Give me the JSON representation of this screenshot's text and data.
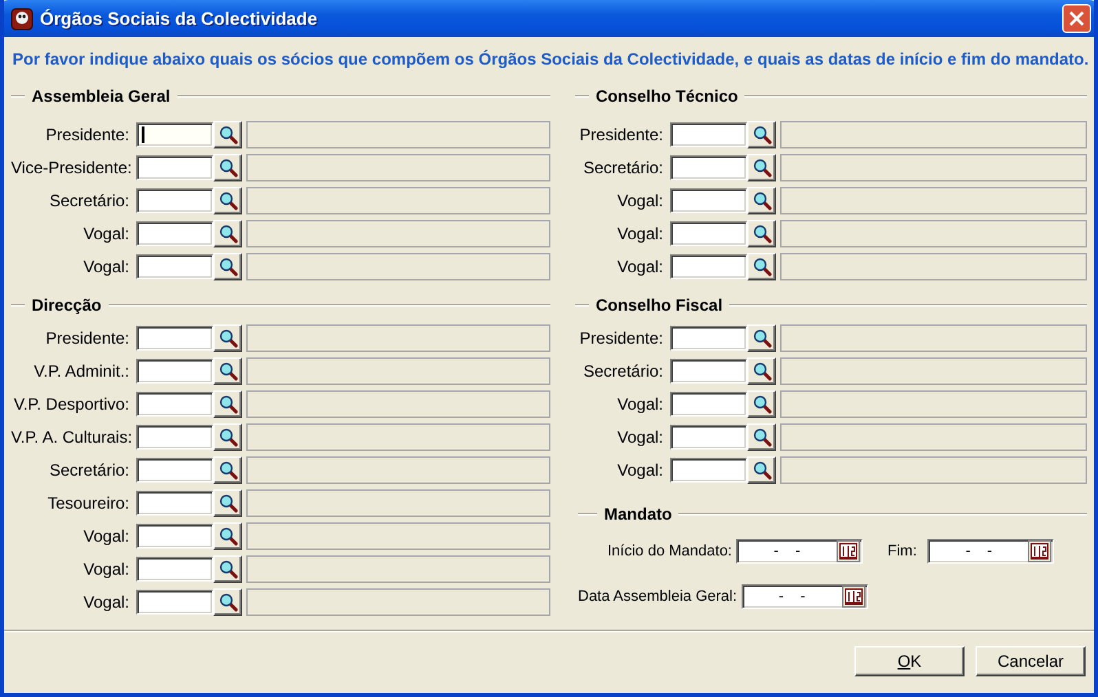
{
  "window": {
    "title": "Órgãos Sociais da Colectividade"
  },
  "instructions": "Por favor indique abaixo quais os sócios que compõem os Órgãos Sociais da Colectividade, e quais as datas de início e fim do mandato.",
  "left_column": {
    "sections": [
      {
        "title": "Assembleia Geral",
        "kind": "members",
        "rows": [
          {
            "label": "Presidente:",
            "focused": true,
            "name_disabled": true
          },
          {
            "label": "Vice-Presidente:",
            "focused": false,
            "name_disabled": true
          },
          {
            "label": "Secretário:",
            "focused": false,
            "name_disabled": true
          },
          {
            "label": "Vogal:",
            "focused": false,
            "name_disabled": true
          },
          {
            "label": "Vogal:",
            "focused": false,
            "name_disabled": true
          }
        ]
      },
      {
        "title": "Direcção",
        "kind": "members",
        "rows": [
          {
            "label": "Presidente:",
            "focused": false,
            "name_disabled": true
          },
          {
            "label": "V.P. Adminit.:",
            "focused": false,
            "name_disabled": true
          },
          {
            "label": "V.P. Desportivo:",
            "focused": false,
            "name_disabled": true
          },
          {
            "label": "V.P. A. Culturais:",
            "focused": false,
            "name_disabled": true
          },
          {
            "label": "Secretário:",
            "focused": false,
            "name_disabled": true
          },
          {
            "label": "Tesoureiro:",
            "focused": false,
            "name_disabled": true
          },
          {
            "label": "Vogal:",
            "focused": false,
            "name_disabled": true
          },
          {
            "label": "Vogal:",
            "focused": false,
            "name_disabled": true
          },
          {
            "label": "Vogal:",
            "focused": false,
            "name_disabled": true
          }
        ]
      }
    ]
  },
  "right_column": {
    "sections": [
      {
        "title": "Conselho Técnico",
        "kind": "members",
        "rows": [
          {
            "label": "Presidente:",
            "focused": false,
            "name_disabled": true
          },
          {
            "label": "Secretário:",
            "focused": false,
            "name_disabled": true
          },
          {
            "label": "Vogal:",
            "focused": false,
            "name_disabled": true
          },
          {
            "label": "Vogal:",
            "focused": false,
            "name_disabled": true
          },
          {
            "label": "Vogal:",
            "focused": false,
            "name_disabled": true
          }
        ]
      },
      {
        "title": "Conselho Fiscal",
        "kind": "members",
        "rows": [
          {
            "label": "Presidente:",
            "focused": false,
            "name_disabled": true
          },
          {
            "label": "Secretário:",
            "focused": false,
            "name_disabled": true
          },
          {
            "label": "Vogal:",
            "focused": false,
            "name_disabled": true
          },
          {
            "label": "Vogal:",
            "focused": false,
            "name_disabled": true
          },
          {
            "label": "Vogal:",
            "focused": false,
            "name_disabled": true
          }
        ]
      },
      {
        "title": "Mandato",
        "kind": "dates",
        "rows": [
          {
            "fields": [
              {
                "label": "Início do Mandato:",
                "value": "- -"
              },
              {
                "label": "Fim:",
                "value": "- -"
              }
            ]
          },
          {
            "fields": [
              {
                "label": "Data Assembleia Geral:",
                "value": "- -"
              }
            ]
          }
        ]
      }
    ]
  },
  "buttons": [
    {
      "label": "OK",
      "underlined_first_letter": true
    },
    {
      "label": "Cancelar",
      "underlined_first_letter": false
    }
  ]
}
